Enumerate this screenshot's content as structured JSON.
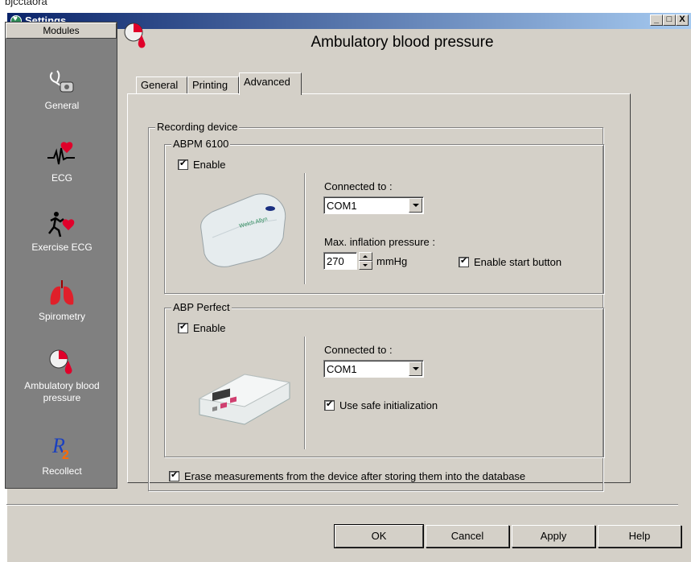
{
  "top_strip_text": "bjcctaora",
  "window": {
    "title": "Settings",
    "title_buttons": [
      "_",
      "□",
      "X"
    ]
  },
  "sidebar": {
    "header": "Modules",
    "items": [
      {
        "label": "General",
        "icon": "stethoscope-icon"
      },
      {
        "label": "ECG",
        "icon": "ecg-heart-icon"
      },
      {
        "label": "Exercise ECG",
        "icon": "runner-heart-icon"
      },
      {
        "label": "Spirometry",
        "icon": "lungs-icon"
      },
      {
        "label": "Ambulatory blood pressure",
        "icon": "clock-drop-icon"
      },
      {
        "label": "Recollect",
        "icon": "r2-logo-icon"
      }
    ]
  },
  "main": {
    "title": "Ambulatory blood pressure",
    "tabs": [
      "General",
      "Printing",
      "Advanced"
    ],
    "active_tab": "Advanced",
    "recording_group": "Recording device",
    "abpm": {
      "group": "ABPM 6100",
      "enable_label": "Enable",
      "enable_checked": true,
      "connected_label": "Connected to :",
      "port": "COM1",
      "pressure_label": "Max. inflation pressure :",
      "pressure_value": "270",
      "pressure_unit": "mmHg",
      "start_button_label": "Enable start button",
      "start_button_checked": true
    },
    "abp_perfect": {
      "group": "ABP Perfect",
      "enable_label": "Enable",
      "enable_checked": true,
      "connected_label": "Connected to :",
      "port": "COM1",
      "safe_init_label": "Use safe initialization",
      "safe_init_checked": true
    },
    "erase_label": "Erase measurements from the device after storing them into the database",
    "erase_checked": true
  },
  "buttons": {
    "ok": "OK",
    "cancel": "Cancel",
    "apply": "Apply",
    "help": "Help"
  }
}
